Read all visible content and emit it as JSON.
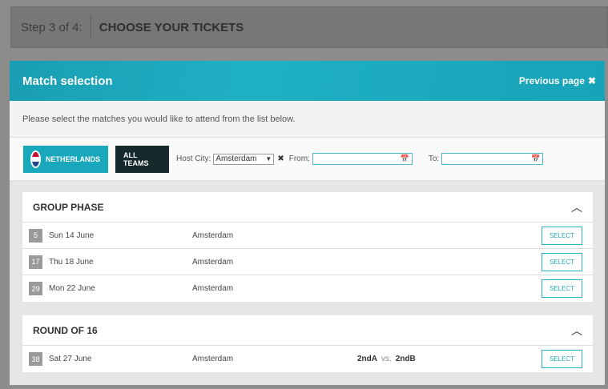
{
  "step": {
    "number": "Step 3 of 4:",
    "title": "CHOOSE YOUR TICKETS"
  },
  "modal": {
    "title": "Match selection",
    "previous_page": "Previous page",
    "intro": "Please select the matches you would like to attend from the list below."
  },
  "filters": {
    "team_nl": "NETHERLANDS",
    "team_all": "ALL TEAMS",
    "host_city_label": "Host City:",
    "host_city_value": "Amsterdam",
    "from_label": "From:",
    "to_label": "To:"
  },
  "sections": [
    {
      "title": "GROUP PHASE",
      "rows": [
        {
          "num": "5",
          "date": "Sun 14 June",
          "city": "Amsterdam",
          "select": "SELECT"
        },
        {
          "num": "17",
          "date": "Thu 18 June",
          "city": "Amsterdam",
          "select": "SELECT"
        },
        {
          "num": "29",
          "date": "Mon 22 June",
          "city": "Amsterdam",
          "select": "SELECT"
        }
      ]
    },
    {
      "title": "ROUND OF 16",
      "rows": [
        {
          "num": "38",
          "date": "Sat 27 June",
          "city": "Amsterdam",
          "home": "2ndA",
          "vs": "vs.",
          "away": "2ndB",
          "select": "SELECT"
        }
      ]
    }
  ],
  "colors": {
    "accent": "#19a7bb",
    "dark": "#162a2c",
    "flag_red": "#c8102e",
    "flag_blue": "#21468b"
  },
  "icons": {
    "close": "close-icon",
    "calendar": "calendar-icon",
    "chevron_up": "chevron-up-icon"
  }
}
